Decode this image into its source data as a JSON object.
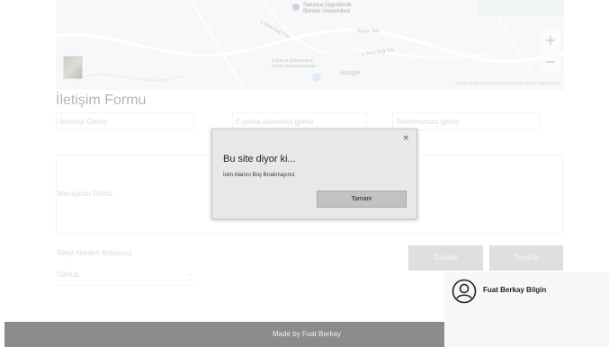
{
  "map": {
    "labels": {
      "university_main": "Sakarya Uygulamalı",
      "university_main_2": "Bilimler Üniversitesi",
      "university_state": "Sakarya Üniversitesi",
      "university_state_2": "Devlet Konservatuvarı",
      "road_1": "2. Nolu Bağ Yolu",
      "road_2": "2. Nolu Bağ Yolu",
      "road_3": "Bahçe Yolu",
      "google": "Google",
      "footer": "Harita verileri ©2020   Kullanım Şartları   Harita hatası bildirin"
    },
    "zoom_in": "+",
    "zoom_out": "−"
  },
  "form": {
    "title": "İletişim Formu",
    "name_placeholder": "İsiminizi Giriniz",
    "email_placeholder": "E-posta adresinizi giriniz",
    "phone_placeholder": "Telefonunuzu giriniz",
    "message_placeholder": "Mesajınızı Giriniz",
    "source_label": "Siteyi Nerden Buldunuz",
    "source_selected": "GitHub",
    "send_label": "Gönder",
    "clear_label": "Temizle"
  },
  "dialog": {
    "close": "×",
    "title": "Bu site diyor ki...",
    "message": "İsim Alanını Boş Bırakmayınız",
    "ok_label": "Tamam"
  },
  "footer": {
    "text": "Made by Fuat Berkay"
  },
  "user": {
    "name": "Fuat Berkay Bilgin"
  }
}
